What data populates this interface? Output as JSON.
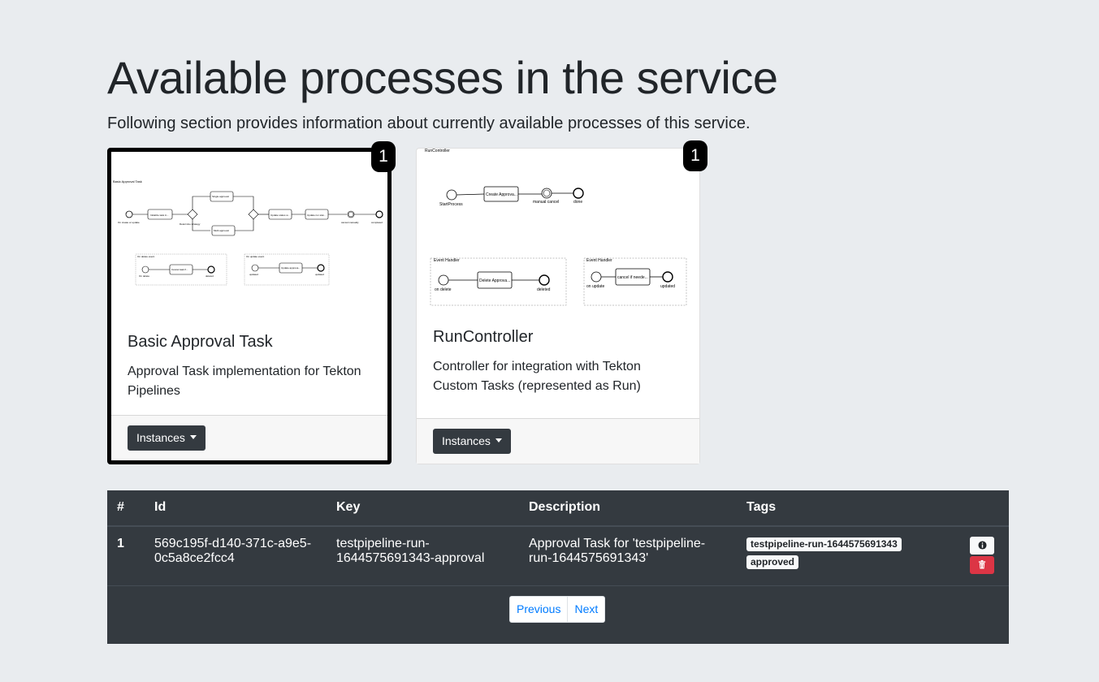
{
  "header": {
    "title": "Available processes in the service",
    "lead": "Following section provides information about currently available processes of this service."
  },
  "processes": [
    {
      "title": "Basic Approval Task",
      "description": "Approval Task implementation for Tekton Pipelines",
      "instances_count": "1",
      "button_label": "Instances",
      "selected": true,
      "diagram": {
        "pool_label": "Basic Approval Task",
        "start_label": "On create or update",
        "task_1": "Initialize task in...",
        "gw_label": "Determine strategy",
        "task_top": "Single approval",
        "task_bottom": "Multi approval",
        "task_2": "Update status w...",
        "task_3": "Update run stat...",
        "event_label": "cancel manually",
        "end_label": "completed",
        "sub1_label": "On delete event",
        "sub1_start": "On delete",
        "sub1_task": "Cancel task if...",
        "sub1_end": "deleted",
        "sub2_label": "On update event",
        "sub2_start": "updated",
        "sub2_task": "Update approva...",
        "sub2_end": "updated"
      }
    },
    {
      "title": "RunController",
      "description": "Controller for integration with Tekton Custom Tasks (represented as Run)",
      "instances_count": "1",
      "button_label": "Instances",
      "selected": false,
      "diagram": {
        "pool_label": "RunController",
        "start_label": "StartProcess",
        "task_1": "Create Approva...",
        "event_label": "manual cancel",
        "end_label": "done",
        "sub1_label": "Event Handler",
        "sub1_start": "on delete",
        "sub1_task": "Delete Approva...",
        "sub1_end": "deleted",
        "sub2_label": "Event Handler",
        "sub2_start": "on update",
        "sub2_task": "cancel if neede...",
        "sub2_end": "updated"
      }
    }
  ],
  "instances_table": {
    "columns": [
      "#",
      "Id",
      "Key",
      "Description",
      "Tags"
    ],
    "rows": [
      {
        "num": "1",
        "id": "569c195f-d140-371c-a9e5-0c5a8ce2fcc4",
        "key": "testpipeline-run-1644575691343-approval",
        "description": "Approval Task for 'testpipeline-run-1644575691343'",
        "tags": [
          "testpipeline-run-1644575691343",
          "approved"
        ]
      }
    ],
    "previous_label": "Previous",
    "next_label": "Next"
  },
  "icons": {
    "info": "info-circle-icon",
    "delete": "trash-icon"
  },
  "colors": {
    "background": "#e9ecef",
    "dark": "#343a40",
    "danger": "#dc3545",
    "link": "#007bff"
  }
}
